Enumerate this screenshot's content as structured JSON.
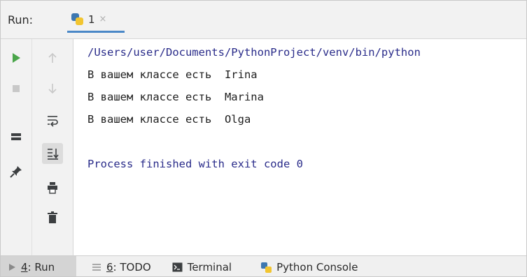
{
  "header": {
    "run_label": "Run:",
    "tab": {
      "label": "1",
      "close": "×"
    }
  },
  "toolbar": {
    "left": [
      {
        "name": "run-icon",
        "glyph": "▶",
        "color": "#4aa54a"
      },
      {
        "name": "stop-icon",
        "glyph": "■",
        "color": "#c8c8c8"
      },
      {
        "name": "layout-icon",
        "glyph": "▬",
        "color": "#3c3f41"
      },
      {
        "name": "pin-icon",
        "glyph": "📌",
        "color": "#3c3f41"
      }
    ],
    "right": [
      {
        "name": "arrow-up-icon",
        "glyph": "↑",
        "color": "#c8c8c8"
      },
      {
        "name": "arrow-down-icon",
        "glyph": "↓",
        "color": "#c8c8c8"
      },
      {
        "name": "soft-wrap-icon",
        "glyph": "⇌",
        "color": "#3c3f41"
      },
      {
        "name": "scroll-to-end-icon",
        "glyph": "⇣",
        "color": "#3c3f41"
      },
      {
        "name": "print-icon",
        "glyph": "🖶",
        "color": "#3c3f41"
      },
      {
        "name": "trash-icon",
        "glyph": "🗑",
        "color": "#3c3f41"
      }
    ]
  },
  "console": {
    "path": "/Users/user/Documents/PythonProject/venv/bin/python",
    "lines": [
      "В вашем классе есть  Irina",
      "В вашем классе есть  Marina",
      "В вашем классе есть  Olga"
    ],
    "finished": "Process finished with exit code 0"
  },
  "bottom_bar": {
    "run": {
      "num": "4",
      "label": ": Run"
    },
    "todo": {
      "num": "6",
      "label": ": TODO"
    },
    "terminal": "Terminal",
    "python_console": "Python Console"
  },
  "colors": {
    "path_text": "#2a2c8a",
    "tab_underline": "#4a88c7",
    "run_green": "#4aa54a"
  }
}
